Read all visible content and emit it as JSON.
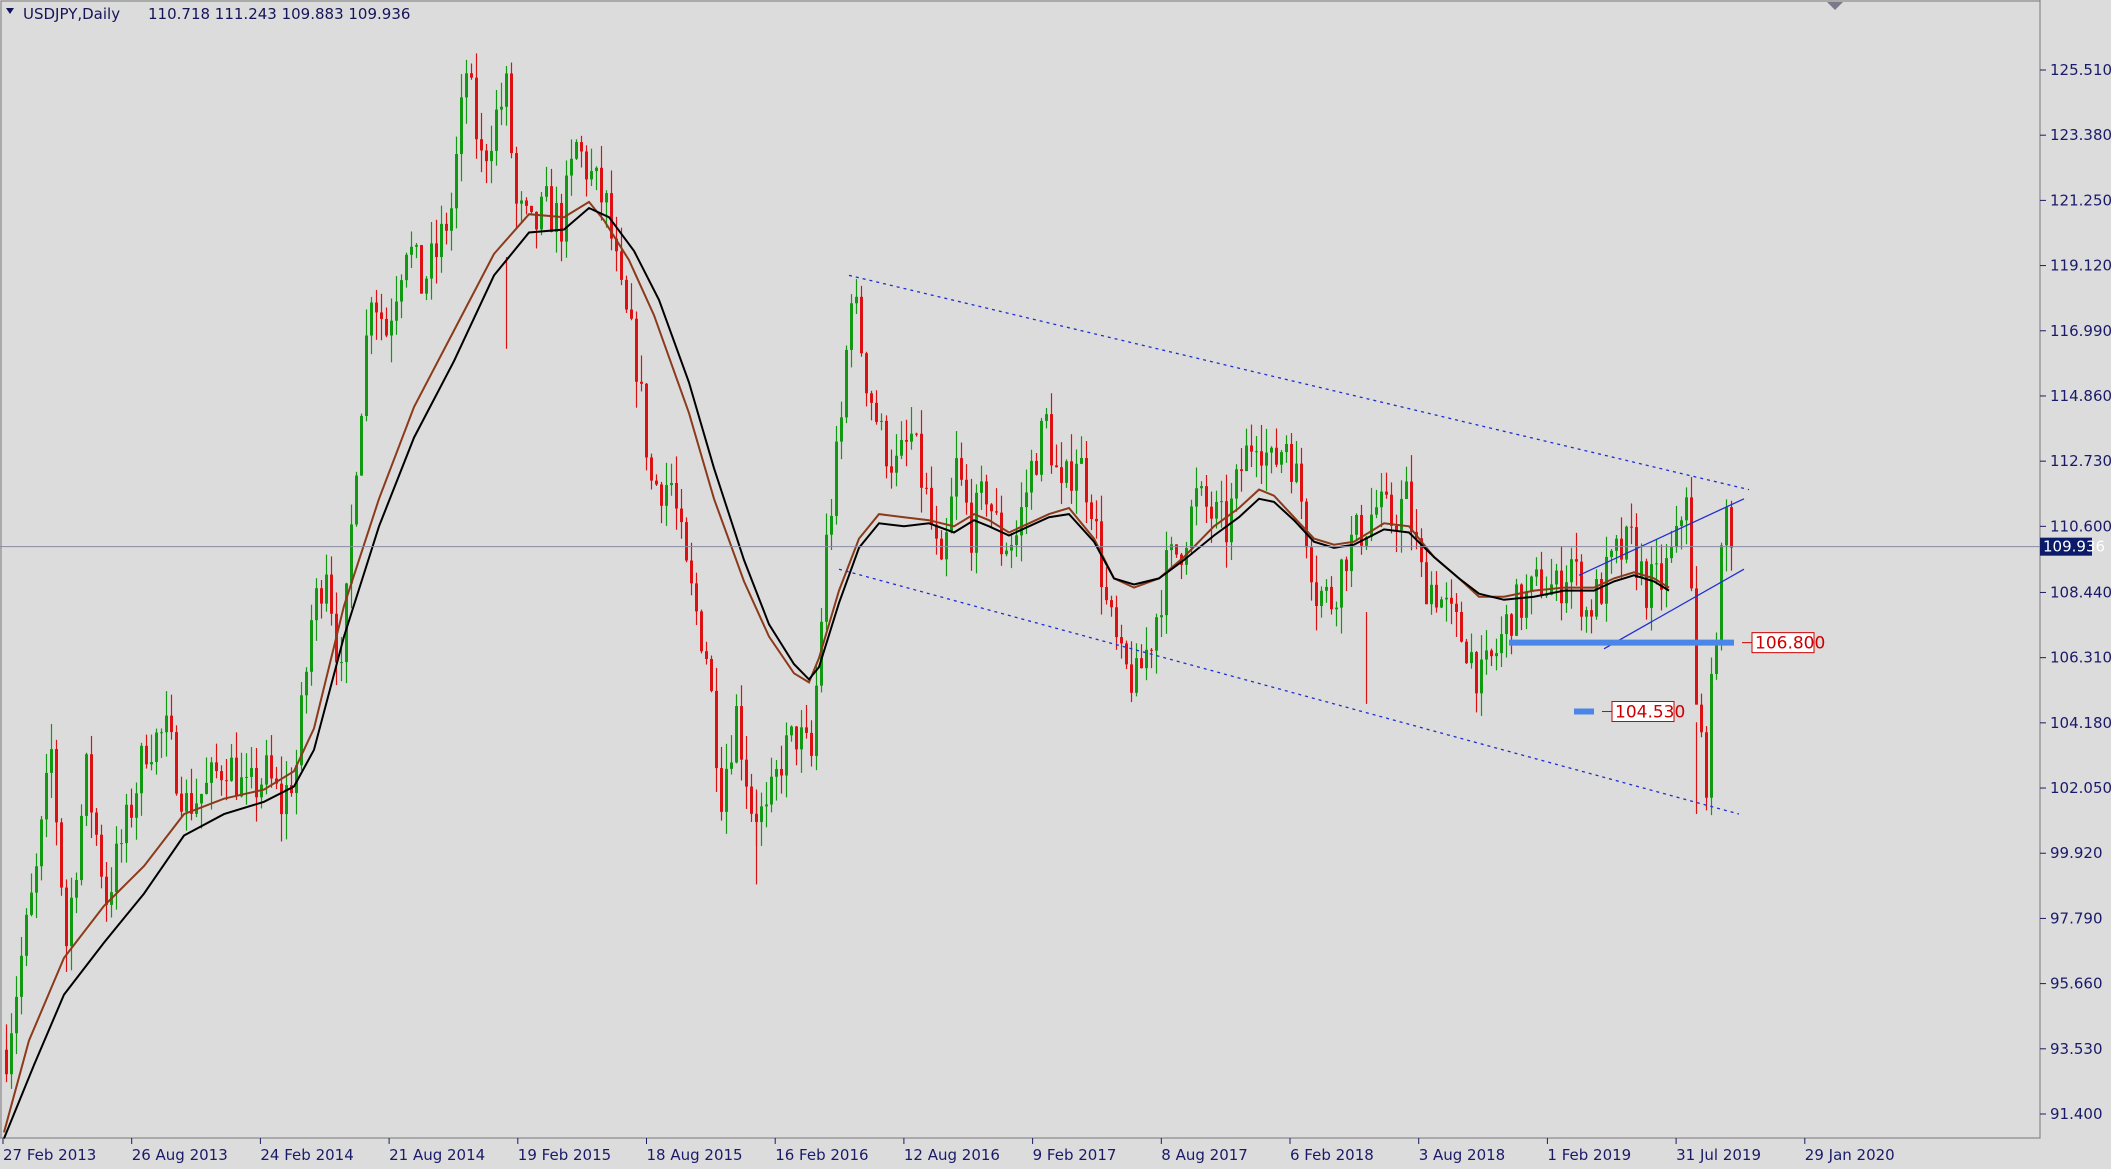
{
  "header": {
    "symbol": "USDJPY,Daily",
    "ohlc": "110.718 111.243 109.883 109.936"
  },
  "colors": {
    "background": "#dcdcdc",
    "axis": "#1a1a6a",
    "bull": "#119911",
    "bear": "#dd1111",
    "ma_fast": "#8b3a1a",
    "ma_slow": "#000000",
    "trend": "#1f2fd0",
    "level": "#4a86e8",
    "annotation": "#cc0000"
  },
  "chart_data": {
    "type": "candlestick",
    "instrument": "USDJPY",
    "timeframe": "Daily",
    "last_price": "109.936",
    "ylim": [
      90.7,
      126.9
    ],
    "x_ticks": [
      "27 Feb 2013",
      "26 Aug 2013",
      "24 Feb 2014",
      "21 Aug 2014",
      "19 Feb 2015",
      "18 Aug 2015",
      "16 Feb 2016",
      "12 Aug 2016",
      "9 Feb 2017",
      "8 Aug 2017",
      "6 Feb 2018",
      "3 Aug 2018",
      "1 Feb 2019",
      "31 Jul 2019",
      "29 Jan 2020"
    ],
    "y_ticks": [
      "125.510",
      "123.380",
      "121.250",
      "119.120",
      "116.990",
      "114.860",
      "112.730",
      "110.600",
      "108.440",
      "106.310",
      "104.180",
      "102.050",
      "99.920",
      "97.790",
      "95.660",
      "93.530",
      "91.400"
    ],
    "price_path": [
      [
        0,
        93.5
      ],
      [
        3,
        96.5
      ],
      [
        6,
        99.2
      ],
      [
        9,
        103.2
      ],
      [
        12,
        97.0
      ],
      [
        16,
        102.5
      ],
      [
        20,
        98.5
      ],
      [
        24,
        100.8
      ],
      [
        28,
        103.5
      ],
      [
        32,
        103.8
      ],
      [
        36,
        101.5
      ],
      [
        40,
        102.0
      ],
      [
        44,
        103.0
      ],
      [
        48,
        101.8
      ],
      [
        52,
        102.5
      ],
      [
        55,
        101.5
      ],
      [
        58,
        102.8
      ],
      [
        61,
        107.5
      ],
      [
        64,
        109.5
      ],
      [
        67,
        105.5
      ],
      [
        70,
        113.0
      ],
      [
        73,
        118.5
      ],
      [
        76,
        117.0
      ],
      [
        80,
        120.0
      ],
      [
        83,
        118.5
      ],
      [
        86,
        119.5
      ],
      [
        89,
        121.0
      ],
      [
        92,
        125.5
      ],
      [
        95,
        122.5
      ],
      [
        98,
        124.0
      ],
      [
        100,
        124.8
      ],
      [
        102,
        121.0
      ],
      [
        105,
        120.2
      ],
      [
        108,
        121.0
      ],
      [
        111,
        120.5
      ],
      [
        114,
        123.0
      ],
      [
        117,
        122.0
      ],
      [
        120,
        121.0
      ],
      [
        123,
        118.0
      ],
      [
        126,
        116.0
      ],
      [
        129,
        112.0
      ],
      [
        133,
        112.0
      ],
      [
        136,
        109.0
      ],
      [
        140,
        106.5
      ],
      [
        143,
        102.0
      ],
      [
        146,
        104.5
      ],
      [
        149,
        101.5
      ],
      [
        152,
        101.0
      ],
      [
        155,
        103.0
      ],
      [
        158,
        103.8
      ],
      [
        161,
        103.0
      ],
      [
        164,
        110.0
      ],
      [
        167,
        114.0
      ],
      [
        169,
        118.5
      ],
      [
        172,
        115.5
      ],
      [
        175,
        113.5
      ],
      [
        178,
        112.5
      ],
      [
        181,
        113.5
      ],
      [
        184,
        111.5
      ],
      [
        187,
        108.8
      ],
      [
        190,
        112.5
      ],
      [
        193,
        110.5
      ],
      [
        196,
        111.8
      ],
      [
        199,
        110.0
      ],
      [
        202,
        110.3
      ],
      [
        205,
        112.5
      ],
      [
        208,
        114.0
      ],
      [
        211,
        111.5
      ],
      [
        214,
        113.0
      ],
      [
        217,
        111.5
      ],
      [
        220,
        108.0
      ],
      [
        223,
        106.0
      ],
      [
        226,
        105.5
      ],
      [
        229,
        107.0
      ],
      [
        232,
        109.2
      ],
      [
        235,
        110.0
      ],
      [
        238,
        111.5
      ],
      [
        241,
        111.0
      ],
      [
        244,
        110.5
      ],
      [
        247,
        112.5
      ],
      [
        250,
        113.8
      ],
      [
        253,
        112.5
      ],
      [
        256,
        113.5
      ],
      [
        259,
        111.5
      ],
      [
        262,
        108.5
      ],
      [
        265,
        108.2
      ],
      [
        268,
        109.8
      ],
      [
        271,
        110.5
      ],
      [
        274,
        111.2
      ],
      [
        277,
        110.8
      ],
      [
        280,
        111.5
      ],
      [
        283,
        109.0
      ],
      [
        286,
        108.5
      ],
      [
        289,
        107.5
      ],
      [
        292,
        106.8
      ],
      [
        295,
        105.5
      ],
      [
        298,
        106.5
      ],
      [
        301,
        107.8
      ],
      [
        304,
        108.2
      ],
      [
        307,
        108.8
      ],
      [
        310,
        108.5
      ],
      [
        313,
        109.5
      ],
      [
        316,
        107.8
      ],
      [
        319,
        108.6
      ],
      [
        322,
        109.6
      ],
      [
        325,
        110.0
      ],
      [
        328,
        108.6
      ],
      [
        331,
        108.8
      ],
      [
        334,
        110.0
      ],
      [
        336,
        112.0
      ],
      [
        338,
        104.5
      ],
      [
        340,
        102.5
      ],
      [
        342,
        107.5
      ],
      [
        344,
        111.0
      ],
      [
        346,
        109.9
      ]
    ],
    "ma_fast": [
      [
        0,
        90.8
      ],
      [
        5,
        93.8
      ],
      [
        12,
        96.5
      ],
      [
        20,
        98.2
      ],
      [
        28,
        99.5
      ],
      [
        36,
        101.2
      ],
      [
        44,
        101.7
      ],
      [
        52,
        102.0
      ],
      [
        58,
        102.6
      ],
      [
        62,
        104.0
      ],
      [
        68,
        108.0
      ],
      [
        75,
        111.5
      ],
      [
        82,
        114.5
      ],
      [
        90,
        117.0
      ],
      [
        98,
        119.5
      ],
      [
        105,
        120.8
      ],
      [
        112,
        120.7
      ],
      [
        117,
        121.2
      ],
      [
        120,
        120.6
      ],
      [
        125,
        119.3
      ],
      [
        130,
        117.5
      ],
      [
        137,
        114.3
      ],
      [
        142,
        111.5
      ],
      [
        148,
        108.8
      ],
      [
        153,
        107.0
      ],
      [
        158,
        105.8
      ],
      [
        161,
        105.5
      ],
      [
        163,
        106.3
      ],
      [
        167,
        108.5
      ],
      [
        171,
        110.2
      ],
      [
        175,
        111.0
      ],
      [
        180,
        110.9
      ],
      [
        185,
        110.8
      ],
      [
        190,
        110.6
      ],
      [
        194,
        111.0
      ],
      [
        197,
        110.8
      ],
      [
        201,
        110.4
      ],
      [
        205,
        110.7
      ],
      [
        209,
        111.0
      ],
      [
        213,
        111.2
      ],
      [
        218,
        110.2
      ],
      [
        222,
        108.9
      ],
      [
        226,
        108.6
      ],
      [
        231,
        108.9
      ],
      [
        236,
        109.6
      ],
      [
        242,
        110.6
      ],
      [
        247,
        111.2
      ],
      [
        251,
        111.8
      ],
      [
        254,
        111.6
      ],
      [
        258,
        110.9
      ],
      [
        262,
        110.2
      ],
      [
        266,
        110.0
      ],
      [
        270,
        110.1
      ],
      [
        276,
        110.7
      ],
      [
        281,
        110.6
      ],
      [
        286,
        109.6
      ],
      [
        291,
        108.9
      ],
      [
        295,
        108.3
      ],
      [
        300,
        108.3
      ],
      [
        306,
        108.5
      ],
      [
        312,
        108.6
      ],
      [
        318,
        108.6
      ],
      [
        322,
        108.9
      ],
      [
        326,
        109.1
      ],
      [
        330,
        108.9
      ],
      [
        333,
        108.6
      ]
    ],
    "ma_slow": [
      [
        0,
        90.6
      ],
      [
        6,
        93.0
      ],
      [
        12,
        95.3
      ],
      [
        20,
        97.0
      ],
      [
        28,
        98.6
      ],
      [
        36,
        100.5
      ],
      [
        44,
        101.2
      ],
      [
        52,
        101.6
      ],
      [
        58,
        102.1
      ],
      [
        62,
        103.3
      ],
      [
        68,
        107.0
      ],
      [
        75,
        110.6
      ],
      [
        82,
        113.5
      ],
      [
        90,
        116.0
      ],
      [
        98,
        118.8
      ],
      [
        105,
        120.2
      ],
      [
        112,
        120.3
      ],
      [
        117,
        121.0
      ],
      [
        121,
        120.7
      ],
      [
        126,
        119.6
      ],
      [
        131,
        118.0
      ],
      [
        137,
        115.3
      ],
      [
        142,
        112.5
      ],
      [
        148,
        109.5
      ],
      [
        153,
        107.4
      ],
      [
        158,
        106.1
      ],
      [
        161,
        105.6
      ],
      [
        163,
        106.0
      ],
      [
        167,
        108.1
      ],
      [
        171,
        109.9
      ],
      [
        175,
        110.7
      ],
      [
        180,
        110.6
      ],
      [
        185,
        110.7
      ],
      [
        190,
        110.4
      ],
      [
        194,
        110.8
      ],
      [
        197,
        110.6
      ],
      [
        201,
        110.3
      ],
      [
        205,
        110.6
      ],
      [
        209,
        110.9
      ],
      [
        213,
        111.0
      ],
      [
        218,
        110.1
      ],
      [
        222,
        108.9
      ],
      [
        226,
        108.7
      ],
      [
        231,
        108.9
      ],
      [
        236,
        109.5
      ],
      [
        242,
        110.3
      ],
      [
        247,
        110.9
      ],
      [
        251,
        111.5
      ],
      [
        254,
        111.4
      ],
      [
        258,
        110.8
      ],
      [
        262,
        110.1
      ],
      [
        266,
        109.9
      ],
      [
        270,
        110.0
      ],
      [
        276,
        110.5
      ],
      [
        281,
        110.4
      ],
      [
        286,
        109.6
      ],
      [
        291,
        108.9
      ],
      [
        295,
        108.4
      ],
      [
        300,
        108.2
      ],
      [
        306,
        108.3
      ],
      [
        312,
        108.5
      ],
      [
        318,
        108.5
      ],
      [
        322,
        108.8
      ],
      [
        326,
        109.0
      ],
      [
        330,
        108.8
      ],
      [
        333,
        108.5
      ]
    ],
    "trendlines": [
      {
        "style": "dotted",
        "from": [
          169,
          118.8
        ],
        "to": [
          349,
          111.8
        ]
      },
      {
        "style": "dotted",
        "from": [
          167,
          109.2
        ],
        "to": [
          347,
          101.2
        ]
      },
      {
        "style": "solid",
        "from": [
          315,
          109.0
        ],
        "to": [
          348,
          111.5
        ]
      },
      {
        "style": "solid",
        "from": [
          320,
          106.6
        ],
        "to": [
          348,
          109.2
        ]
      }
    ],
    "levels": [
      {
        "label": "106.800",
        "value": 106.8,
        "from": 301,
        "to": 346
      },
      {
        "label": "104.530",
        "value": 104.55,
        "from": 314,
        "to": 318
      }
    ],
    "series": [
      {
        "name": "",
        "values": []
      }
    ]
  }
}
